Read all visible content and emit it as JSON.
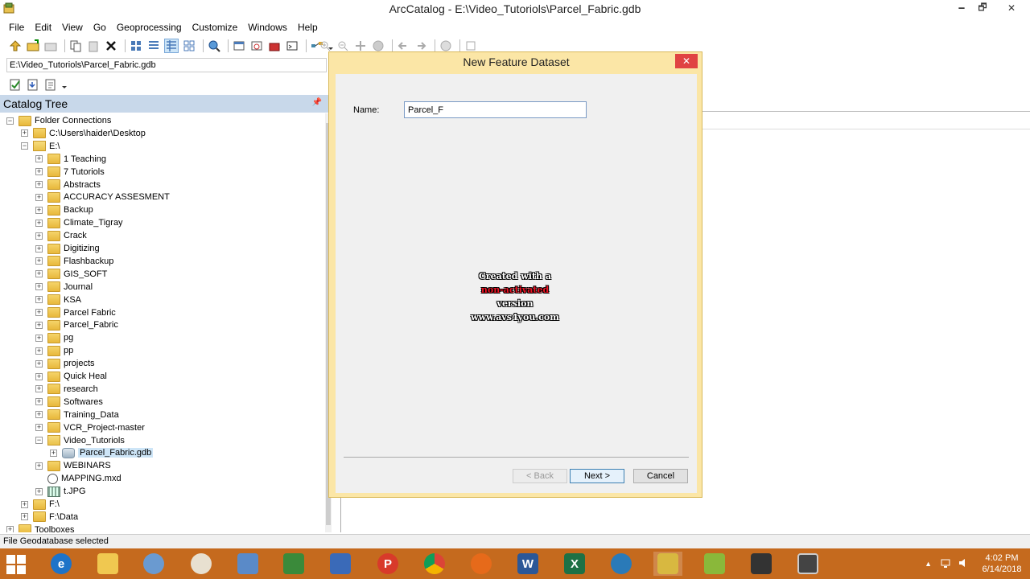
{
  "window": {
    "title": "ArcCatalog - E:\\Video_Tutoriols\\Parcel_Fabric.gdb",
    "minimize": "🗕",
    "maximize": "🗗",
    "close": "✕"
  },
  "menu": [
    "File",
    "Edit",
    "View",
    "Go",
    "Geoprocessing",
    "Customize",
    "Windows",
    "Help"
  ],
  "address": "E:\\Video_Tutoriols\\Parcel_Fabric.gdb",
  "catalog": {
    "title": "Catalog Tree",
    "pin": "📌",
    "items": [
      {
        "label": "Folder Connections",
        "level": 0,
        "expander": "−",
        "icon": "folder"
      },
      {
        "label": "C:\\Users\\haider\\Desktop",
        "level": 1,
        "expander": "+",
        "icon": "folder"
      },
      {
        "label": "E:\\",
        "level": 1,
        "expander": "−",
        "icon": "open-folder"
      },
      {
        "label": "1 Teaching",
        "level": 2,
        "expander": "+",
        "icon": "folder"
      },
      {
        "label": "7 Tutoriols",
        "level": 2,
        "expander": "+",
        "icon": "folder"
      },
      {
        "label": "Abstracts",
        "level": 2,
        "expander": "+",
        "icon": "folder"
      },
      {
        "label": "ACCURACY ASSESMENT",
        "level": 2,
        "expander": "+",
        "icon": "folder"
      },
      {
        "label": "Backup",
        "level": 2,
        "expander": "+",
        "icon": "folder"
      },
      {
        "label": "Climate_Tigray",
        "level": 2,
        "expander": "+",
        "icon": "folder"
      },
      {
        "label": "Crack",
        "level": 2,
        "expander": "+",
        "icon": "folder"
      },
      {
        "label": "Digitizing",
        "level": 2,
        "expander": "+",
        "icon": "folder"
      },
      {
        "label": "Flashbackup",
        "level": 2,
        "expander": "+",
        "icon": "folder"
      },
      {
        "label": "GIS_SOFT",
        "level": 2,
        "expander": "+",
        "icon": "folder"
      },
      {
        "label": "Journal",
        "level": 2,
        "expander": "+",
        "icon": "folder"
      },
      {
        "label": "KSA",
        "level": 2,
        "expander": "+",
        "icon": "folder"
      },
      {
        "label": "Parcel Fabric",
        "level": 2,
        "expander": "+",
        "icon": "folder"
      },
      {
        "label": "Parcel_Fabric",
        "level": 2,
        "expander": "+",
        "icon": "folder"
      },
      {
        "label": "pg",
        "level": 2,
        "expander": "+",
        "icon": "folder"
      },
      {
        "label": "pp",
        "level": 2,
        "expander": "+",
        "icon": "folder"
      },
      {
        "label": "projects",
        "level": 2,
        "expander": "+",
        "icon": "folder"
      },
      {
        "label": "Quick Heal",
        "level": 2,
        "expander": "+",
        "icon": "folder"
      },
      {
        "label": "research",
        "level": 2,
        "expander": "+",
        "icon": "folder"
      },
      {
        "label": "Softwares",
        "level": 2,
        "expander": "+",
        "icon": "folder"
      },
      {
        "label": "Training_Data",
        "level": 2,
        "expander": "+",
        "icon": "folder"
      },
      {
        "label": "VCR_Project-master",
        "level": 2,
        "expander": "+",
        "icon": "folder"
      },
      {
        "label": "Video_Tutoriols",
        "level": 2,
        "expander": "−",
        "icon": "open-folder"
      },
      {
        "label": "Parcel_Fabric.gdb",
        "level": 3,
        "expander": "+",
        "icon": "gdb",
        "selected": true
      },
      {
        "label": "WEBINARS",
        "level": 2,
        "expander": "+",
        "icon": "folder"
      },
      {
        "label": "MAPPING.mxd",
        "level": 2,
        "expander": "",
        "icon": "mxd"
      },
      {
        "label": "t.JPG",
        "level": 2,
        "expander": "+",
        "icon": "jpg"
      },
      {
        "label": "F:\\",
        "level": 1,
        "expander": "+",
        "icon": "folder"
      },
      {
        "label": "F:\\Data",
        "level": 1,
        "expander": "+",
        "icon": "folder"
      },
      {
        "label": "Toolboxes",
        "level": 0,
        "expander": "+",
        "icon": "folder"
      }
    ]
  },
  "status": "File Geodatabase selected",
  "dialog": {
    "title": "New Feature Dataset",
    "close": "✕",
    "name_label": "Name:",
    "name_value": "Parcel_F",
    "back": "< Back",
    "next": "Next >",
    "cancel": "Cancel"
  },
  "watermark": {
    "line1": "Created with a",
    "line2a": "non-activated",
    "line2b": " version",
    "line3": "www.avs4you.com"
  },
  "taskbar": {
    "time": "4:02 PM",
    "date": "6/14/2018",
    "tray_arrow": "▲"
  }
}
